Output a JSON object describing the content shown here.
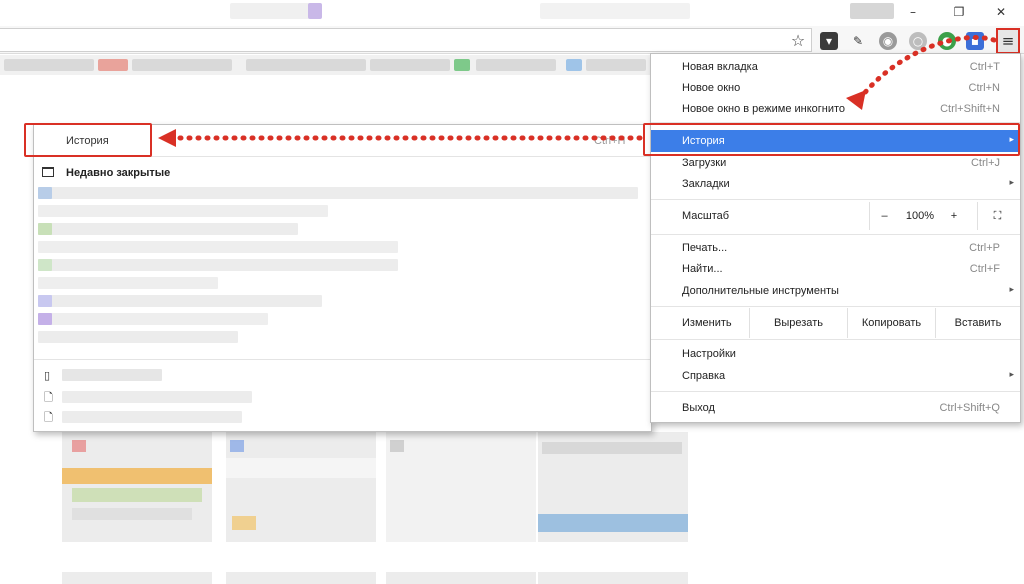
{
  "window": {
    "minimize_glyph": "–",
    "maximize_glyph": "❐",
    "close_glyph": "✕"
  },
  "toolbar": {
    "star_icon": "☆",
    "menu_icon": "≡"
  },
  "history_submenu": {
    "title": "История",
    "shortcut": "Ctrl+H",
    "recently_closed": "Недавно закрытые"
  },
  "main_menu": {
    "new_tab": {
      "label": "Новая вкладка",
      "shortcut": "Ctrl+T"
    },
    "new_window": {
      "label": "Новое окно",
      "shortcut": "Ctrl+N"
    },
    "incognito": {
      "label": "Новое окно в режиме инкогнито",
      "shortcut": "Ctrl+Shift+N"
    },
    "history": {
      "label": "История",
      "arrow": "▸"
    },
    "downloads": {
      "label": "Загрузки",
      "shortcut": "Ctrl+J"
    },
    "bookmarks": {
      "label": "Закладки",
      "arrow": "▸"
    },
    "zoom": {
      "label": "Масштаб",
      "minus": "–",
      "value": "100%",
      "plus": "+",
      "fullscreen": "⛶"
    },
    "print": {
      "label": "Печать...",
      "shortcut": "Ctrl+P"
    },
    "find": {
      "label": "Найти...",
      "shortcut": "Ctrl+F"
    },
    "more_tools": {
      "label": "Дополнительные инструменты",
      "arrow": "▸"
    },
    "edit": {
      "label": "Изменить",
      "cut": "Вырезать",
      "copy": "Копировать",
      "paste": "Вставить"
    },
    "settings": {
      "label": "Настройки"
    },
    "help": {
      "label": "Справка",
      "arrow": "▸"
    },
    "exit": {
      "label": "Выход",
      "shortcut": "Ctrl+Shift+Q"
    }
  },
  "colors": {
    "accent": "#3c7ee8",
    "annotation": "#d93025"
  }
}
